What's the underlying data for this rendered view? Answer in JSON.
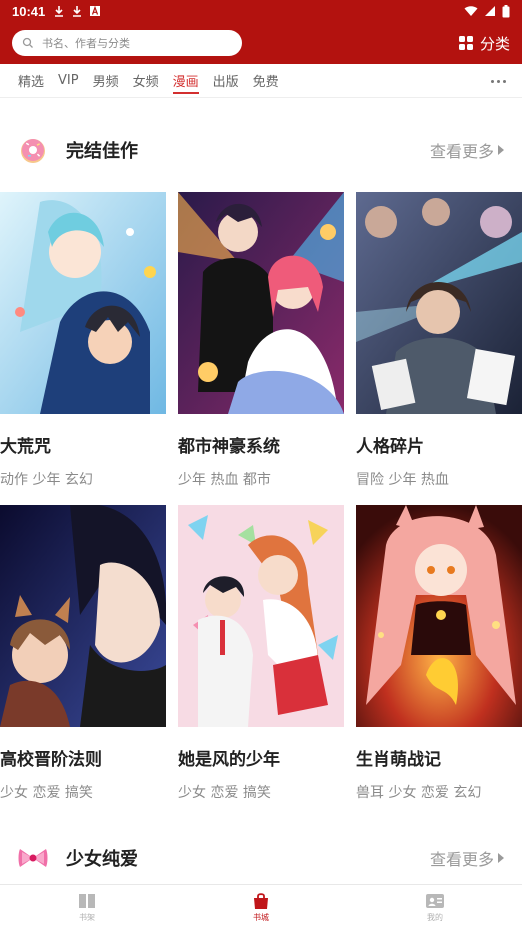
{
  "status_bar": {
    "time": "10:41",
    "icons": [
      "download-icon",
      "download-icon",
      "font-icon",
      "wifi-icon",
      "signal-icon",
      "battery-icon"
    ]
  },
  "header": {
    "search_placeholder": "书名、作者与分类",
    "category_label": "分类",
    "brand_color": "#b3120f"
  },
  "tabs": [
    {
      "label": "精选",
      "active": false
    },
    {
      "label": "VIP",
      "active": false
    },
    {
      "label": "男频",
      "active": false
    },
    {
      "label": "女频",
      "active": false
    },
    {
      "label": "漫画",
      "active": true
    },
    {
      "label": "出版",
      "active": false
    },
    {
      "label": "免费",
      "active": false
    }
  ],
  "sections": [
    {
      "title": "完结佳作",
      "more": "查看更多"
    },
    {
      "title": "少女纯爱",
      "more": "查看更多"
    }
  ],
  "books": [
    {
      "title": "大荒咒",
      "tags": "动作 少年 玄幻"
    },
    {
      "title": "都市神豪系统",
      "tags": "少年 热血 都市"
    },
    {
      "title": "人格碎片",
      "tags": "冒险 少年 热血"
    },
    {
      "title": "高校晋阶法则",
      "tags": "少女 恋爱 搞笑"
    },
    {
      "title": "她是风的少年",
      "tags": "少女 恋爱 搞笑"
    },
    {
      "title": "生肖萌战记",
      "tags": "兽耳 少女 恋爱 玄幻"
    }
  ],
  "bottom_nav": [
    {
      "label": "书架",
      "icon": "book-icon",
      "active": false
    },
    {
      "label": "书城",
      "icon": "bag-icon",
      "active": true
    },
    {
      "label": "我的",
      "icon": "profile-card-icon",
      "active": false
    }
  ]
}
